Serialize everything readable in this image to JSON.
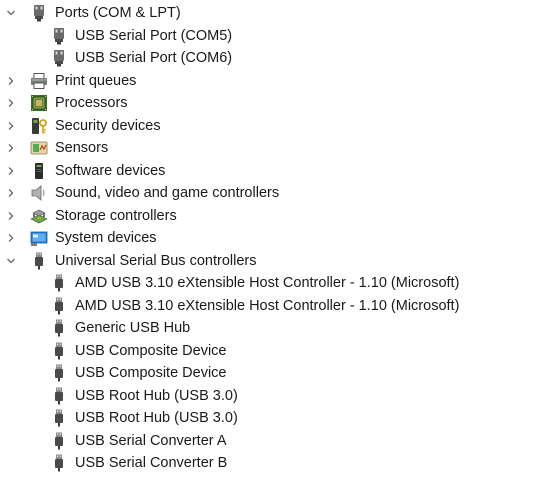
{
  "ports": {
    "label": "Ports (COM & LPT)",
    "expanded": true,
    "children": [
      {
        "label": "USB Serial Port (COM5)"
      },
      {
        "label": "USB Serial Port (COM6)"
      }
    ]
  },
  "categories": [
    {
      "label": "Print queues",
      "icon": "printer-icon",
      "expanded": false
    },
    {
      "label": "Processors",
      "icon": "processor-chip-icon",
      "expanded": false
    },
    {
      "label": "Security devices",
      "icon": "security-key-icon",
      "expanded": false
    },
    {
      "label": "Sensors",
      "icon": "sensor-icon",
      "expanded": false
    },
    {
      "label": "Software devices",
      "icon": "software-device-icon",
      "expanded": false
    },
    {
      "label": "Sound, video and game controllers",
      "icon": "speaker-icon",
      "expanded": false
    },
    {
      "label": "Storage controllers",
      "icon": "storage-controller-icon",
      "expanded": false
    },
    {
      "label": "System devices",
      "icon": "system-device-icon",
      "expanded": false
    }
  ],
  "usb": {
    "label": "Universal Serial Bus controllers",
    "expanded": true,
    "children": [
      {
        "label": "AMD USB 3.10 eXtensible Host Controller - 1.10 (Microsoft)"
      },
      {
        "label": "AMD USB 3.10 eXtensible Host Controller - 1.10 (Microsoft)"
      },
      {
        "label": "Generic USB Hub"
      },
      {
        "label": "USB Composite Device"
      },
      {
        "label": "USB Composite Device"
      },
      {
        "label": "USB Root Hub (USB 3.0)"
      },
      {
        "label": "USB Root Hub (USB 3.0)"
      },
      {
        "label": "USB Serial Converter A"
      },
      {
        "label": "USB Serial Converter B"
      }
    ]
  },
  "colors": {
    "chevron": "#555555",
    "port_icon": "#5a5a5a",
    "usb_icon": "#4a4a4a",
    "system_blue": "#1e7bd8",
    "sensor_green": "#4caf50"
  }
}
